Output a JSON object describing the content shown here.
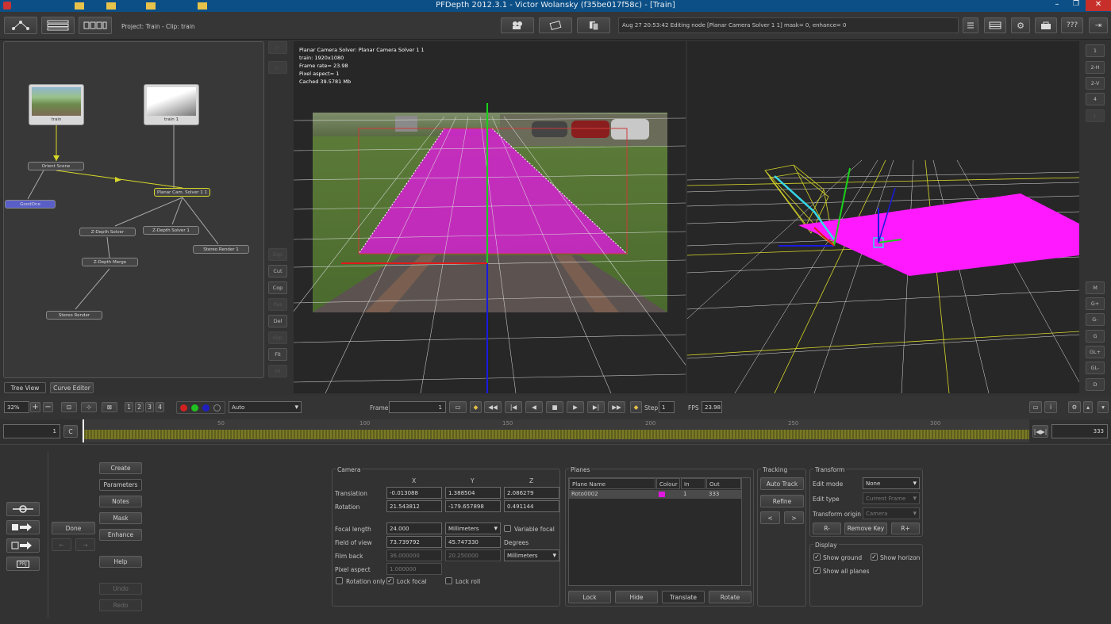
{
  "window": {
    "title": "PFDepth 2012.3.1 - Victor Wolansky (f35be017f58c) - [Train]",
    "controls": [
      "–",
      "❐",
      "✕"
    ]
  },
  "toolbar": {
    "project": "Project: Train - Clip: train",
    "status": "Aug 27 20:53:42 Editing node [Planar Camera Solver 1 1] mask= 0, enhance= 0",
    "help_label": "???"
  },
  "tree": {
    "nodes": {
      "train": "train",
      "train1": "train 1",
      "orient": "Orient Scene",
      "goodone": "GoodOne",
      "planar": "Planar Cam. Solver 1 1",
      "zdepth1": "Z-Depth Solver",
      "zdepth2": "Z-Depth Solver 1",
      "stereo1": "Stereo Render 1",
      "merge": "Z-Depth Merge",
      "stereo": "Stereo Render"
    },
    "tabs": [
      "Tree View",
      "Curve Editor"
    ]
  },
  "sidebar_buttons": [
    "Exp",
    "Cut",
    "Cop",
    "Pas",
    "Del",
    "Grp",
    "Fit",
    "Hi"
  ],
  "viewer": {
    "overlay": [
      "Planar Camera Solver: Planar Camera Solver 1 1",
      "train: 1920x1080",
      "Frame rate= 23.98",
      "Pixel aspect= 1",
      "Cached 39.5781 Mb"
    ]
  },
  "right_buttons_top": [
    "1",
    "2-H",
    "2-V",
    "4",
    "L"
  ],
  "right_buttons_bottom": [
    "M",
    "G+",
    "G-",
    "G",
    "GL+",
    "GL-",
    "D"
  ],
  "playback": {
    "zoom": "32%",
    "channels": [
      "1",
      "2",
      "3",
      "4"
    ],
    "display_mode": "Auto",
    "frame_label": "Frame",
    "frame": "1",
    "step_label": "Step",
    "step": "1",
    "fps_label": "FPS",
    "fps": "23.98"
  },
  "timeline": {
    "start": "1",
    "c_label": "C",
    "end": "333",
    "ticks": [
      "50",
      "100",
      "150",
      "200",
      "250",
      "300"
    ]
  },
  "left_panel": {
    "nav": [
      "Create",
      "Parameters",
      "Notes",
      "Mask",
      "Enhance",
      "Help",
      "Undo",
      "Redo"
    ],
    "done": "Done",
    "prj": "PRJ"
  },
  "camera": {
    "title": "Camera",
    "col_x": "X",
    "col_y": "Y",
    "col_z": "Z",
    "translation_label": "Translation",
    "translation": [
      "-0.013088",
      "1.388504",
      "2.086279"
    ],
    "rotation_label": "Rotation",
    "rotation": [
      "21.543812",
      "-179.657898",
      "0.491144"
    ],
    "focal_label": "Focal length",
    "focal": "24.000",
    "focal_units": "Millimeters",
    "variable_focal": "Variable focal",
    "fov_label": "Field of view",
    "fov": [
      "73.739792",
      "45.747330"
    ],
    "fov_units": "Degrees",
    "filmback_label": "Film back",
    "filmback": [
      "36.000000",
      "20.250000"
    ],
    "filmback_units": "Millimeters",
    "pixel_aspect_label": "Pixel aspect",
    "pixel_aspect": "1.000000",
    "rotation_only": "Rotation only",
    "lock_focal": "Lock focal",
    "lock_roll": "Lock roll"
  },
  "planes": {
    "title": "Planes",
    "columns": [
      "Plane Name",
      "Colour",
      "In",
      "Out"
    ],
    "rows": [
      {
        "name": "Roto0002",
        "colour": "#e019e0",
        "in": "1",
        "out": "333"
      }
    ],
    "buttons": [
      "Lock",
      "Hide",
      "Translate",
      "Rotate"
    ]
  },
  "tracking": {
    "title": "Tracking",
    "auto_track": "Auto Track",
    "refine": "Refine",
    "prev": "<",
    "next": ">"
  },
  "transform": {
    "title": "Transform",
    "edit_mode_label": "Edit mode",
    "edit_mode": "None",
    "edit_type_label": "Edit type",
    "edit_type": "Current Frame",
    "origin_label": "Transform origin",
    "origin": "Camera",
    "r_minus": "R-",
    "remove_key": "Remove Key",
    "r_plus": "R+"
  },
  "display": {
    "title": "Display",
    "show_ground": "Show ground",
    "show_horizon": "Show horizon",
    "show_all_planes": "Show all planes"
  },
  "colors": {
    "magenta": "#e019e0",
    "accent": "#2a6fb4",
    "node_blue": "#5a5fc8",
    "timeline": "#8a8a2a"
  }
}
